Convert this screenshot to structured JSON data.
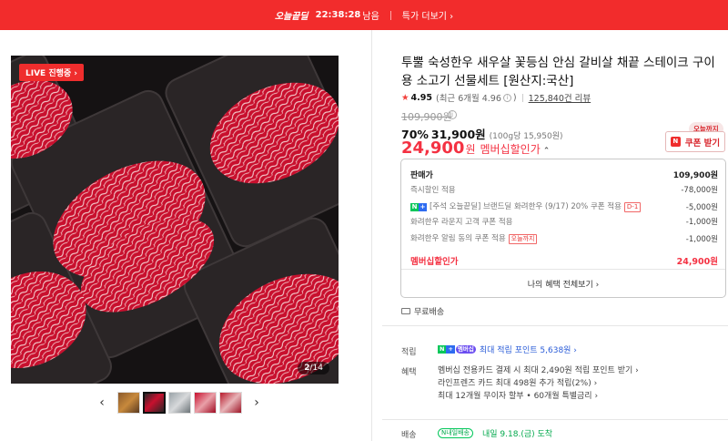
{
  "banner": {
    "brand": "오늘끝딜",
    "time": "22:38:28",
    "remaining": "남음",
    "more": "특가 더보기 ›"
  },
  "gallery": {
    "live_badge": "LIVE 진행중 ›",
    "counter_current": "2",
    "counter_total": "/14",
    "prev": "‹",
    "next": "›",
    "thumbnail_count": 5,
    "active_thumbnail": 2
  },
  "product": {
    "title": "투뿔 숙성한우 새우살 꽃등심 안심 갈비살 채끝 스테이크 구이용 소고기 선물세트 [원산지:국산]",
    "rating_star": "★",
    "rating": "4.95",
    "rating_recent": "(최근 6개월 4.96",
    "rating_recent_close": ")",
    "reviews": "125,840건 리뷰",
    "original_price": "109,900원",
    "discount_rate": "70%",
    "sale_price": "31,900원",
    "unit_price": "(100g당 15,950원)",
    "member_price": "24,900",
    "member_won": "원",
    "member_label": "멤버십할인가",
    "member_caret": "⌃"
  },
  "coupon": {
    "tag": "오늘까지",
    "icon": "N",
    "label": "쿠폰 받기"
  },
  "price_box": {
    "head_label": "판매가",
    "head_value": "109,900원",
    "rows": [
      {
        "label": "즉시할인 적용",
        "value": "-78,000원"
      },
      {
        "label": "[주석 오늘끝딜] 브랜드딜 화려한우 (9/17) 20% 쿠폰 적용",
        "tag": "D-1",
        "value": "-5,000원"
      },
      {
        "label": "화려한우 라운지 고객 쿠폰 적용",
        "value": "-1,000원"
      },
      {
        "label": "화려한우 알림 동의 쿠폰 적용",
        "tag": "오늘까지",
        "value": "-1,000원"
      }
    ],
    "member_label": "멤버십할인가",
    "member_value": "24,900원",
    "benefit_all": "나의 혜택 전체보기 ›"
  },
  "delivery": {
    "free": "무료배송"
  },
  "points": {
    "label": "적립",
    "badge_n": "N",
    "badge_plus": "+",
    "badge_member": "멤버십",
    "text": "최대 적립 포인트 5,638원 ›"
  },
  "benefits": {
    "label": "혜택",
    "lines": [
      "멤버십 전용카드 결제 시 최대 2,490원 적립 포인트 받기 ›",
      "라인프렌즈 카드 최대 498원 추가 적립(2%) ›",
      "최대 12개월 무이자 할부 • 60개월 특별금리 ›"
    ]
  },
  "shipping": {
    "label": "배송",
    "badge": "N내일배송",
    "date": "내일 9.18.(금) 도착"
  },
  "colors": {
    "banner": "#f22c2c",
    "accent": "#f43142",
    "naver_green": "#03c75a",
    "link_blue": "#2a5cd8"
  }
}
